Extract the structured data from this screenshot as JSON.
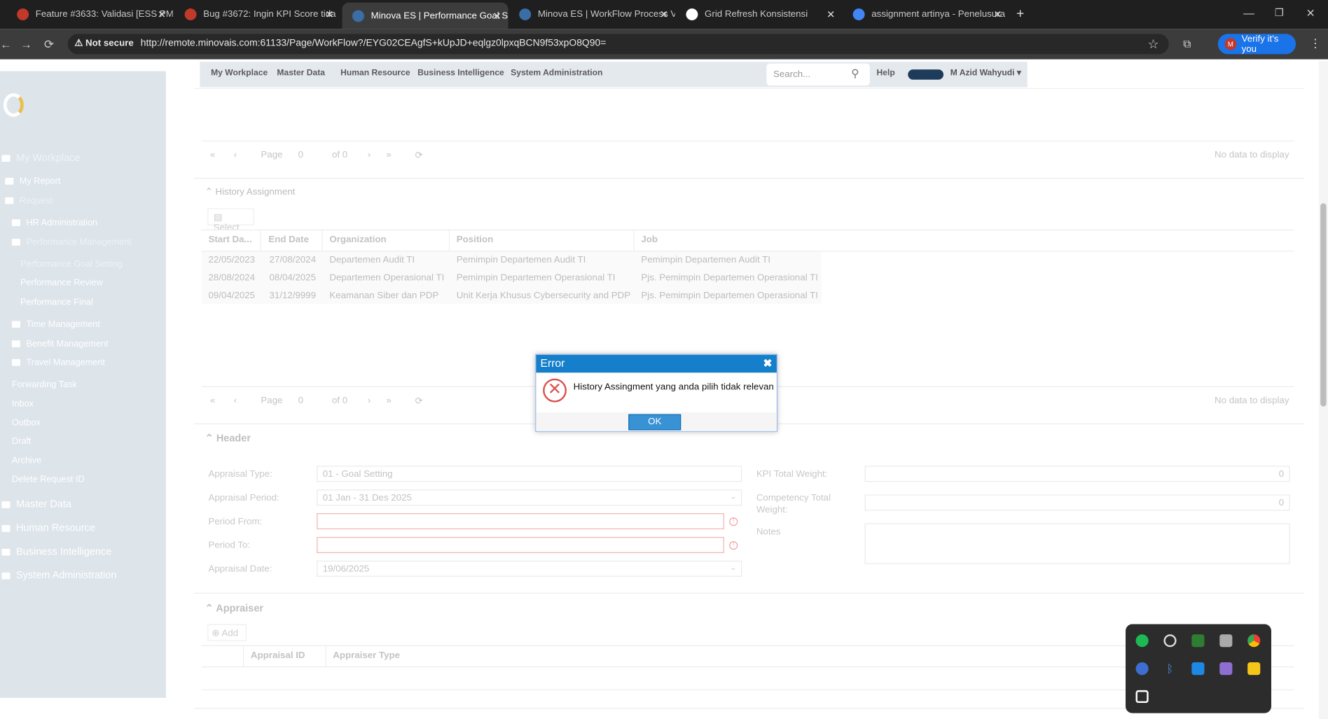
{
  "browser": {
    "tabs": [
      {
        "title": "Feature #3633: Validasi [ESS PM"
      },
      {
        "title": "Bug #3672: Ingin KPI Score tida"
      },
      {
        "title": "Minova ES | Performance Goal S"
      },
      {
        "title": "Minova ES | WorkFlow Process V"
      },
      {
        "title": "Grid Refresh Konsistensi"
      },
      {
        "title": "assignment artinya - Penelusura"
      }
    ],
    "not_secure": "Not secure",
    "url": "http://remote.minovais.com:61133/Page/WorkFlow?/EYG02CEAgfS+kUpJD+eqlgz0lpxqBCN9f53xpO8Q90=",
    "verify_label": "Verify it's you",
    "avatar_initial": "M"
  },
  "nav": {
    "items": [
      "My Workplace",
      "Master Data",
      "Human Resource",
      "Business Intelligence",
      "System Administration"
    ],
    "search_placeholder": "Search...",
    "help": "Help",
    "user": "M Azid Wahyudi"
  },
  "sidebar": {
    "my_workplace": "My Workplace",
    "my_report": "My Report",
    "request": "Request",
    "hr_admin": "HR Administration",
    "perf_mgmt": "Performance Management",
    "perf_goal": "Performance Goal Setting",
    "perf_review": "Performance Review",
    "perf_final": "Performance Final",
    "time": "Time Management",
    "benefit": "Benefit Management",
    "travel": "Travel Management",
    "forwarding": "Forwarding Task",
    "inbox": "Inbox",
    "outbox": "Outbox",
    "draft": "Draft",
    "archive": "Archive",
    "delete_req": "Delete Request ID",
    "master": "Master Data",
    "hr": "Human Resource",
    "bi": "Business Intelligence",
    "sysadmin": "System Administration"
  },
  "pager": {
    "page_label": "Page",
    "page_value": "0",
    "of": "of 0",
    "empty": "No data to display"
  },
  "history": {
    "title": "History Assignment",
    "select": "Select",
    "columns": [
      "Start Da...",
      "End Date",
      "Organization",
      "Position",
      "Job"
    ],
    "rows": [
      [
        "22/05/2023",
        "27/08/2024",
        "Departemen Audit TI",
        "Pemimpin Departemen Audit TI",
        "Pemimpin Departemen Audit TI"
      ],
      [
        "28/08/2024",
        "08/04/2025",
        "Departemen Operasional TI",
        "Pemimpin Departemen Operasional TI",
        "Pjs. Pemimpin Departemen Operasional TI"
      ],
      [
        "09/04/2025",
        "31/12/9999",
        "Keamanan Siber dan PDP",
        "Unit Kerja Khusus Cybersecurity and PDP",
        "Pjs. Pemimpin Departemen Operasional TI"
      ]
    ]
  },
  "header": {
    "title": "Header",
    "appraisal_type_label": "Appraisal Type:",
    "appraisal_type": "01 - Goal Setting",
    "appraisal_period_label": "Appraisal Period:",
    "appraisal_period": "01 Jan - 31 Des 2025",
    "period_from_label": "Period From:",
    "period_to_label": "Period To:",
    "appraisal_date_label": "Appraisal Date:",
    "appraisal_date": "19/06/2025",
    "kpi_label": "KPI Total Weight:",
    "kpi": "0",
    "comp_label_1": "Competency Total",
    "comp_label_2": "Weight:",
    "comp": "0",
    "notes_label": "Notes"
  },
  "appraiser": {
    "title": "Appraiser",
    "add": "Add",
    "columns": [
      "Appraisal ID",
      "Appraiser Type"
    ]
  },
  "dialog": {
    "title": "Error",
    "message": "History Assingment yang anda pilih tidak relevan",
    "ok": "OK"
  }
}
